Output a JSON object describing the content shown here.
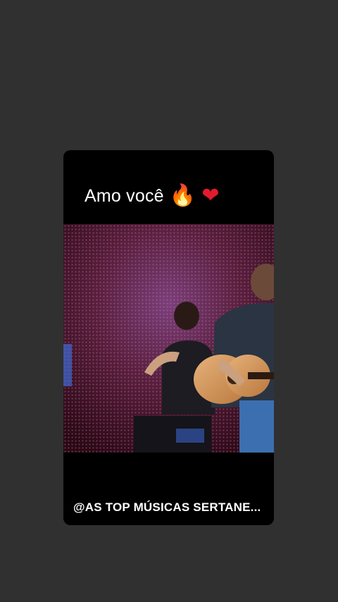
{
  "post": {
    "caption": "Amo você",
    "emojis": [
      {
        "icon": "fire-emoji",
        "glyph": "🔥"
      },
      {
        "icon": "red-heart-emoji",
        "glyph": "❤"
      }
    ],
    "watermark": "@AS TOP MÚSICAS SERTANE..."
  },
  "colors": {
    "background": "#303030",
    "card": "#000000",
    "text": "#ffffff"
  }
}
